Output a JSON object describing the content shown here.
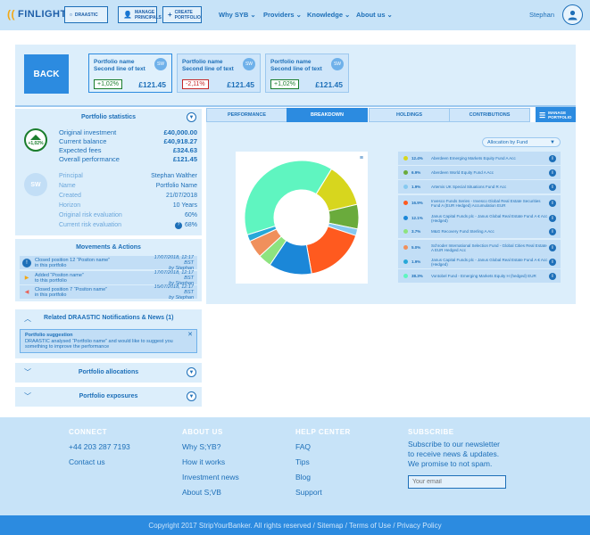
{
  "nav": {
    "brand": "FINLIGHT",
    "btn_draastic": "DRAASTIC",
    "btn_manage_principals": [
      "MANAGE",
      "PRINCIPALS"
    ],
    "btn_create_portfolio": [
      "CREATE",
      "PORTFOLIO"
    ],
    "links": [
      "Why SYB",
      "Providers",
      "Knowledge",
      "About us"
    ],
    "user": "Stephan"
  },
  "portfolios": {
    "back_label": "BACK",
    "cards": [
      {
        "name_line1": "Portfolio name",
        "name_line2": "Second line of text",
        "badge": "SW",
        "change": "+1,02%",
        "direction": "up",
        "value": "£121.45"
      },
      {
        "name_line1": "Portfolio name",
        "name_line2": "Second line of text",
        "badge": "SW",
        "change": "-2,11%",
        "direction": "down",
        "value": "£121.45"
      },
      {
        "name_line1": "Portfolio name",
        "name_line2": "Second line of text",
        "badge": "SW",
        "change": "+1,02%",
        "direction": "up",
        "value": "£121.45"
      }
    ]
  },
  "stats": {
    "title": "Portfolio statistics",
    "trend_badge": "+1,02%",
    "rows": [
      {
        "label": "Original investment",
        "value": "£40,000.00"
      },
      {
        "label": "Current balance",
        "value": "£40,918.27"
      },
      {
        "label": "Expected fees",
        "value": "£324.63"
      },
      {
        "label": "Overall performance",
        "value": "£121.45"
      }
    ],
    "avatar": "SW",
    "details": [
      {
        "label": "Principal",
        "value": "Stephan Walther"
      },
      {
        "label": "Name",
        "value": "Portfolio Name"
      },
      {
        "label": "Created",
        "value": "21/07/2018"
      },
      {
        "label": "Horizon",
        "value": "10 Years"
      },
      {
        "label": "Original risk evaluation",
        "value": "60%"
      },
      {
        "label": "Current risk evaluation",
        "value": "68%"
      }
    ]
  },
  "movements": {
    "title": "Movements & Actions",
    "items": [
      {
        "line1": "Closed position 12 “Positon name”",
        "line2": "in this portfolio",
        "date": "17/07/2018, 12:17 BST",
        "by": "by Stephan"
      },
      {
        "line1": "Added “Positon name”",
        "line2": "to this portfolio",
        "date": "17/07/2018, 12:17 BST",
        "by": "by Stephan"
      },
      {
        "line1": "Closed position 7 “Positon name”",
        "line2": "in this portfolio",
        "date": "15/07/2018, 12:17 BST",
        "by": "by Stephan"
      }
    ]
  },
  "notifications": {
    "title": "Related DRAASTIC Notifications & News (1)",
    "suggestion_title": "Portfolio suggestion",
    "suggestion_text_1": "DRAASTIC analysed “Portfolio name” and would like to suggest you",
    "suggestion_text_2": "something to improve the performance"
  },
  "allocations_title": "Portfolio allocations",
  "exposures_title": "Portfolio exposures",
  "tabs": [
    "PERFORMANCE",
    "BREAKDOWN",
    "HOLDINGS",
    "CONTRIBUTIONS"
  ],
  "manage_portfolio": [
    "MANAGE",
    "PORTFOLIO"
  ],
  "allocation_filter": "Allocation by Fund",
  "chart_data": {
    "type": "pie",
    "subtype": "donut",
    "categories": [
      "Aberdeen Emerging Markets Equity Fund A Acc",
      "Aberdeen World Equity Fund A Acc",
      "Artemis UK Special Situations Fund R Acc",
      "Invesco Funds Series - Invesco Global Real Estate Securities Fund A (EUR Hedged) Accumulation EUR",
      "Janus Capital Funds plc - Janus Global Real Estate Fund A € Acc (Hedged)",
      "M&G Recovery Fund Sterling A Acc",
      "Schroder International Selection Fund - Global Cities Real Estate A EUR Hedged Acc",
      "Janus Capital Funds plc - Janus Global Real Estate Fund A € Acc (Hedged)",
      "Vontobel Fund - Emerging Markets Equity H (hedged) EUR"
    ],
    "labels": [
      "12.4%",
      "6.9%",
      "1.9%",
      "16.9%",
      "12.1%",
      "3.7%",
      "5.0%",
      "1.9%",
      "38.3%"
    ],
    "values": [
      12.4,
      6.9,
      1.9,
      16.9,
      12.1,
      3.7,
      5.0,
      1.9,
      38.3
    ],
    "colors": [
      "#d7d61e",
      "#6aab3c",
      "#86c9f0",
      "#ff5a1f",
      "#1b87d8",
      "#8ee37f",
      "#f0905c",
      "#27a8d8",
      "#5ff5c0"
    ]
  },
  "footer": {
    "connect_title": "CONNECT",
    "phone": "+44 203 287 7193",
    "contact": "Contact us",
    "about_title": "ABOUT US",
    "about_links": [
      "Why S;YB?",
      "How it works",
      "Investment news",
      "About S;VB"
    ],
    "help_title": "HELP CENTER",
    "help_links": [
      "FAQ",
      "Tips",
      "Blog",
      "Support"
    ],
    "subscribe_title": "SUBSCRIBE",
    "subscribe_text": [
      "Subscribe to our newsletter",
      "to receive news & updates.",
      "We promise to not spam."
    ],
    "email_placeholder": "Your email",
    "copyright": "Copyright 2017 StripYourBanker. All rights reserved / Sitemap / Terms of Use / Privacy Policy"
  }
}
